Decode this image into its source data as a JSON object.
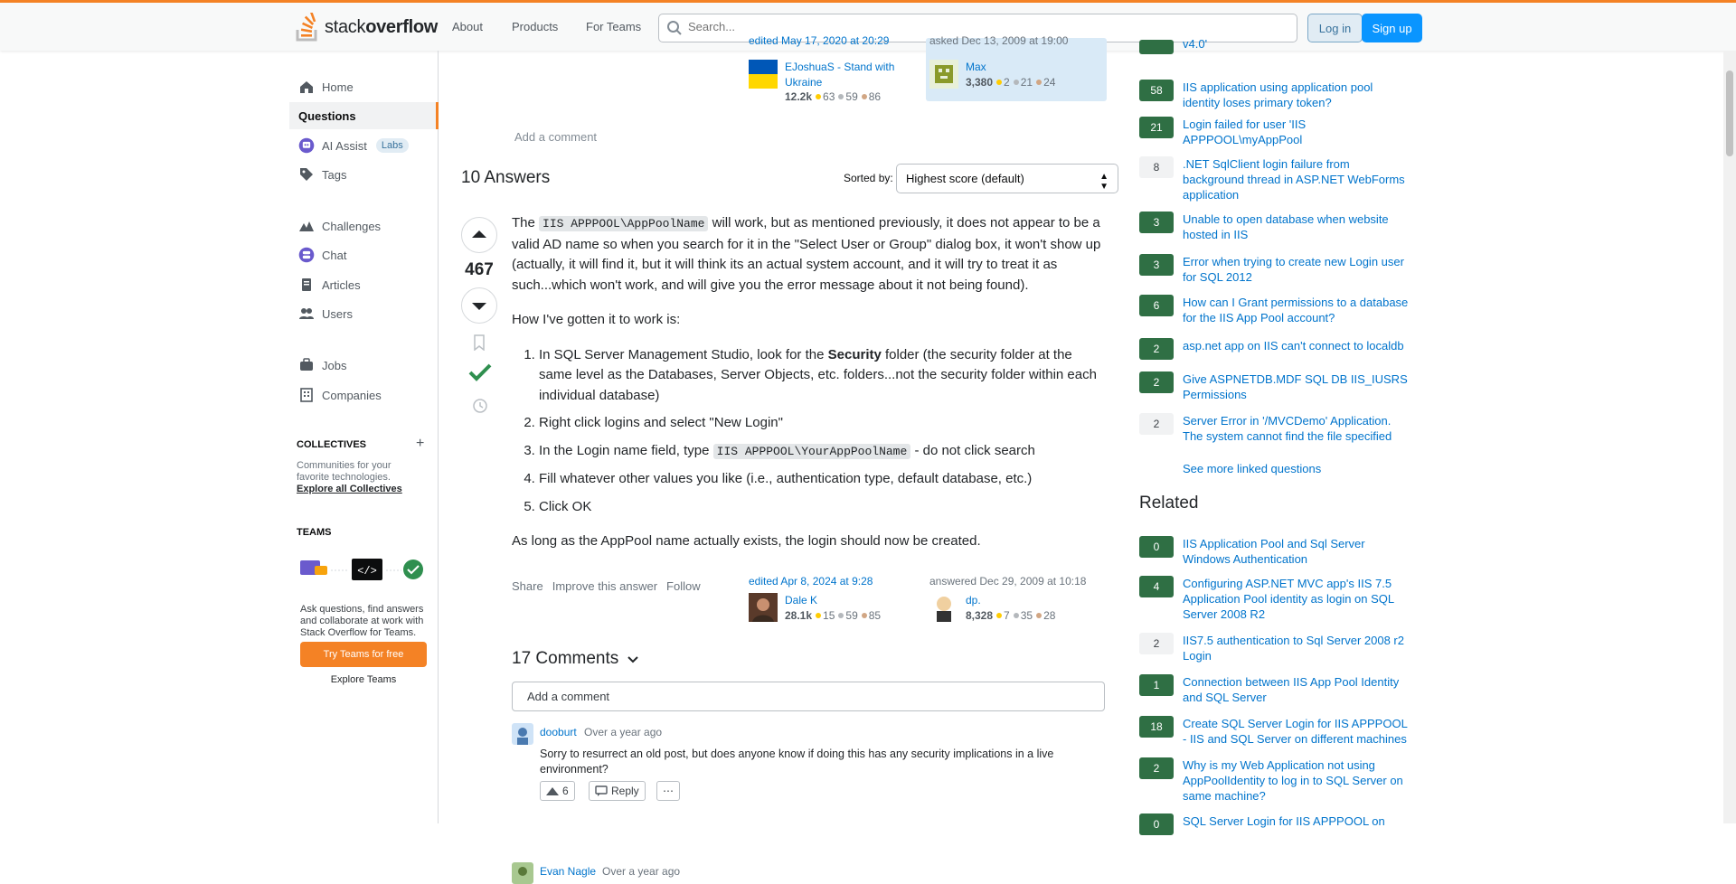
{
  "header": {
    "logo_prefix": "stack",
    "logo_suffix": "overflow",
    "nav": [
      "About",
      "Products",
      "For Teams"
    ],
    "search_placeholder": "Search...",
    "login": "Log in",
    "signup": "Sign up"
  },
  "sidebar": {
    "items": [
      {
        "label": "Home",
        "icon": "home-icon"
      },
      {
        "label": "Questions",
        "icon": "",
        "active": true
      },
      {
        "label": "AI Assist",
        "icon": "ai-assist-icon",
        "badge": "Labs"
      },
      {
        "label": "Tags",
        "icon": "tag-icon"
      },
      {
        "label": "Challenges",
        "icon": "challenges-icon"
      },
      {
        "label": "Chat",
        "icon": "chat-icon"
      },
      {
        "label": "Articles",
        "icon": "articles-icon"
      },
      {
        "label": "Users",
        "icon": "users-icon"
      },
      {
        "label": "Jobs",
        "icon": "jobs-icon"
      },
      {
        "label": "Companies",
        "icon": "companies-icon"
      }
    ],
    "collectives_heading": "COLLECTIVES",
    "collectives_desc": "Communities for your favorite technologies.",
    "collectives_link": "Explore all Collectives",
    "teams_heading": "TEAMS",
    "teams_desc": "Ask questions, find answers and collaborate at work with Stack Overflow for Teams.",
    "teams_button": "Try Teams for free",
    "teams_explore": "Explore Teams"
  },
  "question_footer": {
    "editor": {
      "time": "edited May 17, 2020 at 20:29",
      "name": "EJoshuaS - Stand with Ukraine",
      "rep": "12.2k",
      "gold": "63",
      "silver": "59",
      "bronze": "86"
    },
    "asker": {
      "time": "asked Dec 13, 2009 at 19:00",
      "name": "Max",
      "rep": "3,380",
      "gold": "2",
      "silver": "21",
      "bronze": "24"
    },
    "add_comment": "Add a comment"
  },
  "answers": {
    "heading": "10 Answers",
    "sorted_by": "Sorted by:",
    "sort_value": "Highest score (default)"
  },
  "answer": {
    "score": "467",
    "p1_a": "The ",
    "p1_code": "IIS APPPOOL\\AppPoolName",
    "p1_b": " will work, but as mentioned previously, it does not appear to be a valid AD name so when you search for it in the \"Select User or Group\" dialog box, it won't show up (actually, it will find it, but it will think its an actual system account, and it will try to treat it as such...which won't work, and will give you the error message about it not being found).",
    "p2": "How I've gotten it to work is:",
    "s1_a": "In SQL Server Management Studio, look for the ",
    "s1_b": "Security",
    "s1_c": " folder (the security folder at the same level as the Databases, Server Objects, etc. folders...not the security folder within each individual database)",
    "s2": "Right click logins and select \"New Login\"",
    "s3_a": "In the Login name field, type ",
    "s3_code": "IIS APPPOOL\\YourAppPoolName",
    "s3_b": " - do not click search",
    "s4": "Fill whatever other values you like (i.e., authentication type, default database, etc.)",
    "s5": "Click OK",
    "p3": "As long as the AppPool name actually exists, the login should now be created.",
    "actions": [
      "Share",
      "Improve this answer",
      "Follow"
    ],
    "editor": {
      "time": "edited Apr 8, 2024 at 9:28",
      "name": "Dale K",
      "rep": "28.1k",
      "gold": "15",
      "silver": "59",
      "bronze": "85"
    },
    "answerer": {
      "time": "answered Dec 29, 2009 at 10:18",
      "name": "dp.",
      "rep": "8,328",
      "gold": "7",
      "silver": "35",
      "bronze": "28"
    }
  },
  "comments": {
    "heading": "17 Comments",
    "add": "Add a comment",
    "items": [
      {
        "user": "dooburt",
        "time": "Over a year ago",
        "text": "Sorry to resurrect an old post, but does anyone know if doing this has any security implications in a live environment?",
        "votes": "6",
        "reply": "Reply"
      },
      {
        "user": "Evan Nagle",
        "time": "Over a year ago"
      }
    ]
  },
  "linked": [
    {
      "score": "",
      "title": "v4.0'",
      "accepted": true
    },
    {
      "score": "58",
      "title": "IIS application using application pool identity loses primary token?",
      "accepted": true
    },
    {
      "score": "21",
      "title": "Login failed for user 'IIS APPPOOL\\myAppPool",
      "accepted": true
    },
    {
      "score": "8",
      "title": ".NET SqlClient login failure from background thread in ASP.NET WebForms application",
      "accepted": false
    },
    {
      "score": "3",
      "title": "Unable to open database when website hosted in IIS",
      "accepted": true
    },
    {
      "score": "3",
      "title": "Error when trying to create new Login user for SQL 2012",
      "accepted": true
    },
    {
      "score": "6",
      "title": "How can I Grant permissions to a database for the IIS App Pool account?",
      "accepted": true
    },
    {
      "score": "2",
      "title": "asp.net app on IIS can't connect to localdb",
      "accepted": true
    },
    {
      "score": "2",
      "title": "Give ASPNETDB.MDF SQL DB IIS_IUSRS Permissions",
      "accepted": true
    },
    {
      "score": "2",
      "title": "Server Error in '/MVCDemo' Application. The system cannot find the file specified",
      "accepted": false
    }
  ],
  "see_more": "See more linked questions",
  "related_heading": "Related",
  "related": [
    {
      "score": "0",
      "title": "IIS Application Pool and Sql Server Windows Authentication",
      "accepted": true
    },
    {
      "score": "4",
      "title": "Configuring ASP.NET MVC app's IIS 7.5 Application Pool identity as login on SQL Server 2008 R2",
      "accepted": true
    },
    {
      "score": "2",
      "title": "IIS7.5 authentication to Sql Server 2008 r2 Login",
      "accepted": false
    },
    {
      "score": "1",
      "title": "Connection between IIS App Pool Identity and SQL Server",
      "accepted": true
    },
    {
      "score": "18",
      "title": "Create SQL Server Login for IIS APPPOOL - IIS and SQL Server on different machines",
      "accepted": true
    },
    {
      "score": "2",
      "title": "Why is my Web Application not using AppPoolIdentity to log in to SQL Server on same machine?",
      "accepted": true
    },
    {
      "score": "0",
      "title": "SQL Server Login for IIS APPPOOL on",
      "accepted": true
    }
  ],
  "colors": {
    "accent": "#f48225",
    "link": "#0074cc",
    "accepted": "#2f6f44",
    "button": "#0a95ff"
  }
}
